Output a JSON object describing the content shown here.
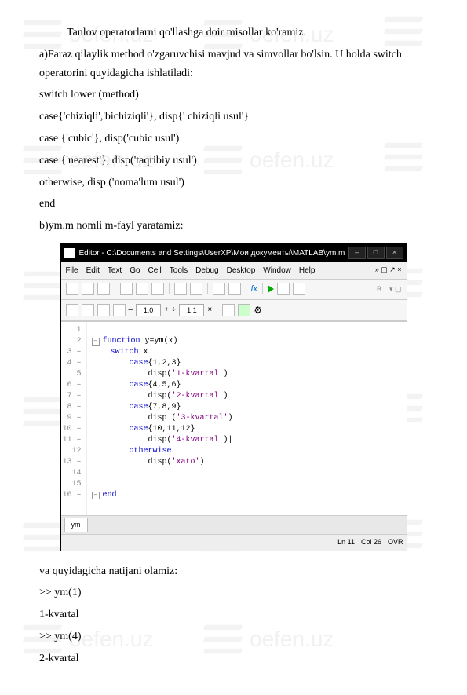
{
  "doc": {
    "p1": "Tanlov operatorlarni qo'llashga doir misollar ko'ramiz.",
    "p2": "a)Faraz qilaylik method o'zgaruvchisi mavjud va simvollar bo'lsin. U holda switch operatorini quyidagicha ishlatiladi:",
    "c1": "switch lower (method)",
    "c2": "case{'chiziqli','bichiziqli'}, disp{' chiziqli usul'}",
    "c3": "case {'cubic'}, disp('cubic usul')",
    "c4": "case {'nearest'}, disp('taqribiy usul')",
    "c5": "otherwise, disp ('noma'lum usul')",
    "c6": "end",
    "p3": "b)ym.m nomli m-fayl yaratamiz:",
    "p4": "va quyidagicha natijani olamiz:",
    "r1": ">> ym(1)",
    "r2": "1-kvartal",
    "r3": ">> ym(4)",
    "r4": "2-kvartal"
  },
  "editor": {
    "title": "Editor - C:\\Documents and Settings\\UserXP\\Мои документы\\MATLAB\\ym.m",
    "menu": [
      "File",
      "Edit",
      "Text",
      "Go",
      "Cell",
      "Tools",
      "Debug",
      "Desktop",
      "Window",
      "Help"
    ],
    "toolbar": {
      "field1": "1.0",
      "field2": "1.1"
    },
    "code": {
      "l1_a": "function",
      "l1_b": " y=ym(x)",
      "l2": "switch",
      "l2_b": " x",
      "l3": "case",
      "l3_b": "{1,2,3}",
      "l4": "disp(",
      "l4_s": "'1-kvartal'",
      "l4_e": ")",
      "l5": "case",
      "l5_b": "{4,5,6}",
      "l6": "disp(",
      "l6_s": "'2-kvartal'",
      "l6_e": ")",
      "l7": "case",
      "l7_b": "{7,8,9}",
      "l8": "disp (",
      "l8_s": "'3-kvartal'",
      "l8_e": ")",
      "l9": "case",
      "l9_b": "{10,11,12}",
      "l10": "disp(",
      "l10_s": "'4-kvartal'",
      "l10_e": ")|",
      "l11": "otherwise",
      "l12": "disp(",
      "l12_s": "'xato'",
      "l12_e": ")",
      "l13": "end"
    },
    "tab": "ym",
    "status": {
      "ln": "Ln 11",
      "col": "Col 26",
      "ovr": "OVR"
    }
  },
  "watermark": "oefen.uz"
}
